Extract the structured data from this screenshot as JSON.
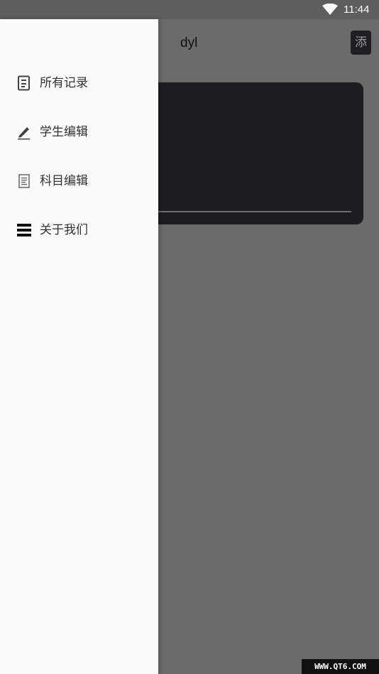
{
  "status_bar": {
    "time": "11:44",
    "wifi_icon": "wifi-icon"
  },
  "app": {
    "title": "dyl",
    "add_button_label": "添"
  },
  "drawer": {
    "items": [
      {
        "label": "所有记录",
        "icon": "records-icon"
      },
      {
        "label": "学生编辑",
        "icon": "pencil-icon"
      },
      {
        "label": "科目编辑",
        "icon": "document-icon"
      },
      {
        "label": "关于我们",
        "icon": "menu-icon"
      }
    ]
  },
  "watermark": "WWW.QT6.COM"
}
